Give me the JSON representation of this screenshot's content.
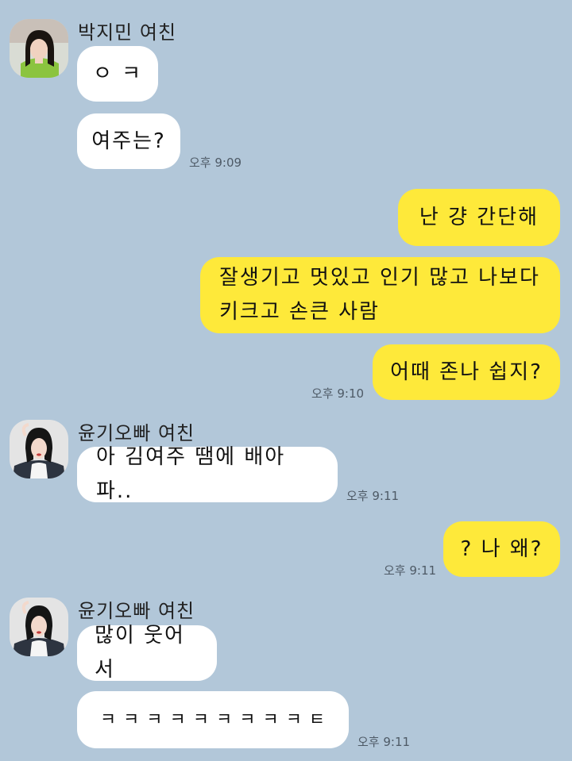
{
  "messages": {
    "g1": {
      "sender": "박지민 여친",
      "m1": "ㅇ ㅋ",
      "m2": "여주는?",
      "time": "오후 9:09"
    },
    "g2": {
      "m1": "난 걍 간단해",
      "m2": "잘생기고 멋있고 인기 많고 나보다\n키크고 손큰 사람",
      "m3": "어때 존나 쉽지?",
      "time": "오후 9:10"
    },
    "g3": {
      "sender": "윤기오빠 여친",
      "m1": "아 김여주 땜에 배아파..",
      "time": "오후 9:11"
    },
    "g4": {
      "m1": "? 나 왜?",
      "time": "오후 9:11"
    },
    "g5": {
      "sender": "윤기오빠 여친",
      "m1": "많이 웃어서",
      "m2": "ㅋ ㅋ ㅋ ㅋ ㅋ ㅋ ㅋ ㅋ ㅋ ㅌ",
      "time": "오후 9:11"
    }
  },
  "colors": {
    "background": "#b2c7d9",
    "incoming_bubble": "#ffffff",
    "outgoing_bubble": "#fee93a"
  }
}
